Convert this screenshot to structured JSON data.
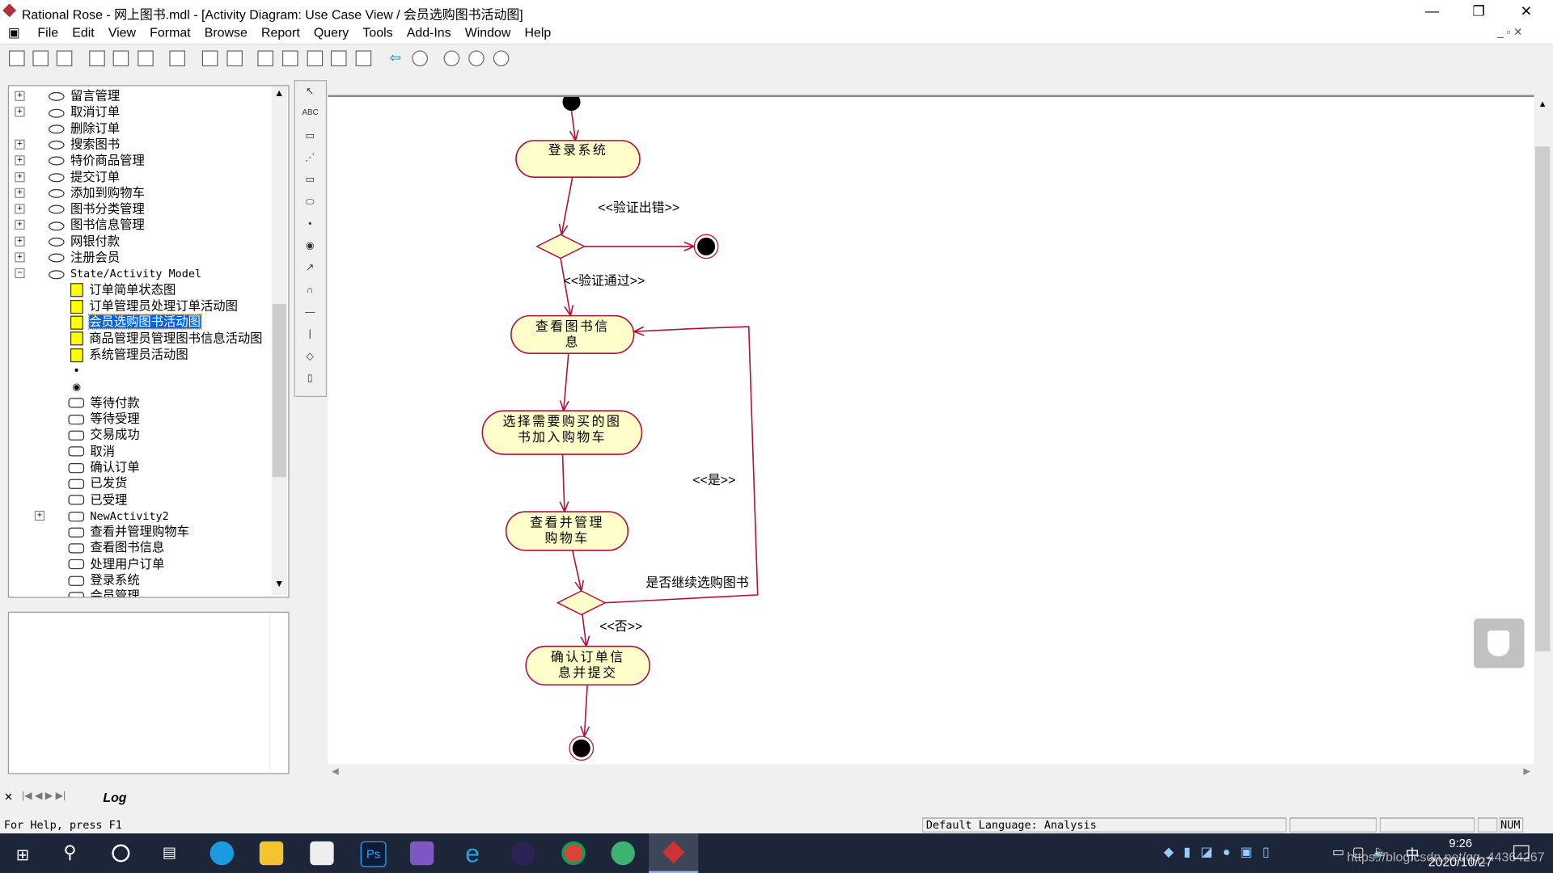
{
  "window": {
    "title": "Rational Rose - 网上图书.mdl - [Activity Diagram: Use Case View / 会员选购图书活动图]",
    "minimize": "—",
    "restore": "❐",
    "close": "✕"
  },
  "menu": [
    "File",
    "Edit",
    "View",
    "Format",
    "Browse",
    "Report",
    "Query",
    "Tools",
    "Add-Ins",
    "Window",
    "Help"
  ],
  "toolbar": [
    "new-icon",
    "open-icon",
    "save-icon",
    "cut-icon",
    "copy-icon",
    "paste-icon",
    "print-icon",
    "context-help-icon",
    "view-doc-icon",
    "browse-class-icon",
    "browse-interaction-icon",
    "browse-component-icon",
    "browse-deployment-icon",
    "browse-parent-icon",
    "browse-previous-icon",
    "zoom-in-icon",
    "zoom-out-icon",
    "fit-in-window-icon",
    "undo-fit-icon"
  ],
  "tree": {
    "usecases": [
      "留言管理",
      "取消订单",
      "删除订单",
      "搜索图书",
      "特价商品管理",
      "提交订单",
      "添加到购物车",
      "图书分类管理",
      "图书信息管理",
      "网银付款",
      "注册会员"
    ],
    "model": "State/Activity Model",
    "diagrams": [
      "订单简单状态图",
      "订单管理员处理订单活动图",
      "会员选购图书活动图",
      "商品管理员管理图书信息活动图",
      "系统管理员活动图"
    ],
    "states": [
      "等待付款",
      "等待受理",
      "交易成功",
      "取消",
      "确认订单",
      "已发货",
      "已受理"
    ],
    "new_activity": "NewActivity2",
    "activities": [
      "查看并管理购物车",
      "查看图书信息",
      "处理用户订单",
      "登录系统",
      "会员管理"
    ]
  },
  "palette": [
    "selection-tool-icon",
    "text-box-icon",
    "note-icon",
    "anchor-note-icon",
    "state-icon",
    "activity-icon",
    "start-state-icon",
    "end-state-icon",
    "transition-icon",
    "self-transition-icon",
    "horizontal-sync-icon",
    "vertical-sync-icon",
    "decision-icon",
    "swimlane-icon"
  ],
  "palette_text": "ABC",
  "diagram": {
    "activities": {
      "login": "登录系统",
      "view_books_1": "查看图书信",
      "view_books_2": "息",
      "select_1": "选择需要购买的图",
      "select_2": "书加入购物车",
      "cart_1": "查看并管理",
      "cart_2": "购物车",
      "confirm_1": "确认订单信",
      "confirm_2": "息并提交"
    },
    "guards": {
      "fail": "<<验证出错>>",
      "pass": "<<验证通过>>",
      "yes": "<<是>>",
      "question": "是否继续选购图书",
      "no": "<<否>>"
    },
    "colors": {
      "activity_fill": "#ffffcc",
      "line": "#b0103c"
    }
  },
  "log_tab": "Log",
  "status": {
    "help": "For Help, press F1",
    "language": "Default Language: Analysis",
    "num": "NUM"
  },
  "taskbar": {
    "time": "9:26",
    "date": "2020/10/27",
    "ime": "中",
    "watermark": "https://blog.csdn.net/qq_44364267"
  }
}
